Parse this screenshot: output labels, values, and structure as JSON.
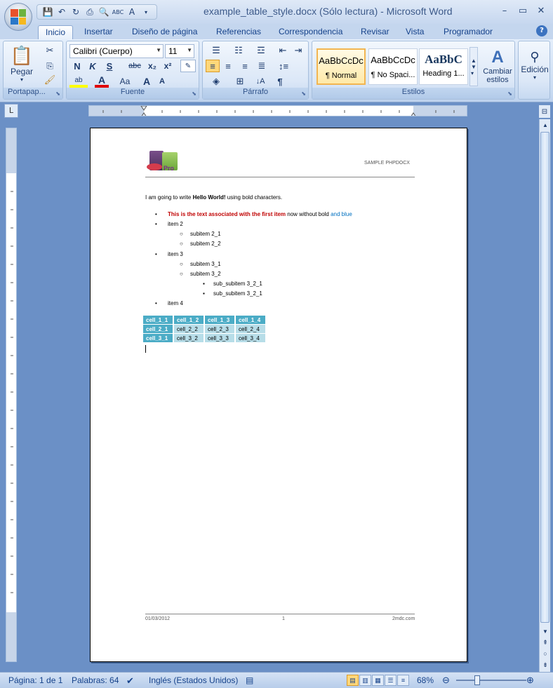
{
  "window": {
    "title": "example_table_style.docx (Sólo lectura) - Microsoft Word",
    "min": "–",
    "max": "▭",
    "close": "✕"
  },
  "ribbon_tabs": [
    "Inicio",
    "Insertar",
    "Diseño de página",
    "Referencias",
    "Correspondencia",
    "Revisar",
    "Vista",
    "Programador"
  ],
  "groups": {
    "portapapeles": {
      "label": "Portapap...",
      "paste": "Pegar"
    },
    "fuente": {
      "label": "Fuente",
      "font_name": "Calibri (Cuerpo)",
      "font_size": "11",
      "bold": "N",
      "italic": "K",
      "underline": "S",
      "strike": "abc",
      "sub": "x₂",
      "sup": "x²",
      "aa": "Aa",
      "grow": "A",
      "shrink": "A"
    },
    "parrafo": {
      "label": "Párrafo"
    },
    "estilos": {
      "label": "Estilos",
      "items": [
        {
          "preview": "AaBbCcDc",
          "name": "¶ Normal"
        },
        {
          "preview": "AaBbCcDc",
          "name": "¶ No Spaci..."
        },
        {
          "preview": "AaBbC",
          "name": "Heading 1..."
        }
      ],
      "change": "Cambiar estilos",
      "change_l1": "Cambiar",
      "change_l2": "estilos"
    },
    "edicion": {
      "label": "Edición"
    }
  },
  "document": {
    "header_right": "SAMPLE PHPDOCX",
    "intro_pre": "I am going to write ",
    "intro_bold": "Hello World!",
    "intro_post": " using bold  characters.",
    "item1_red": "This is the text associated with the first item",
    "item1_mid": " now without  bold  ",
    "item1_blue": "and blue",
    "item2": "item 2",
    "sub2_1": "subitem 2_1",
    "sub2_2": "subitem 2_2",
    "item3": "item 3",
    "sub3_1": "subitem 3_1",
    "sub3_2": "subitem 3_2",
    "subsub3_2_1a": "sub_subitem 3_2_1",
    "subsub3_2_1b": "sub_subitem 3_2_1",
    "item4": "item 4",
    "table": [
      [
        "cell_1_1",
        "cell_1_2",
        "cell_1_3",
        "cell_1_4"
      ],
      [
        "cell_2_1",
        "cell_2_2",
        "cell_2_3",
        "cell_2_4"
      ],
      [
        "cell_3_1",
        "cell_3_2",
        "cell_3_3",
        "cell_3_4"
      ]
    ],
    "footer_left": "01/03/2012",
    "footer_center": "1",
    "footer_right": "2mdc.com"
  },
  "status": {
    "page": "Página: 1 de 1",
    "words": "Palabras: 64",
    "lang": "Inglés (Estados Unidos)",
    "zoom": "68%"
  },
  "colors": {
    "header_cell": "#4bacc6",
    "body_cell": "#b7dde8",
    "red_text": "#c00000",
    "blue_text": "#0070c0"
  }
}
